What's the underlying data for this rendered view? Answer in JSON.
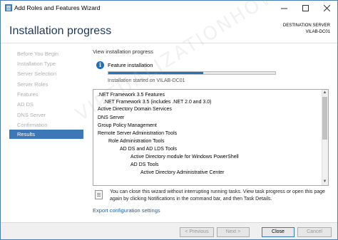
{
  "window": {
    "title": "Add Roles and Features Wizard"
  },
  "header": {
    "title": "Installation progress",
    "destination_label": "DESTINATION SERVER",
    "destination_server": "VILAB-DC01"
  },
  "sidebar": {
    "items": [
      {
        "label": "Before You Begin",
        "active": false
      },
      {
        "label": "Installation Type",
        "active": false
      },
      {
        "label": "Server Selection",
        "active": false
      },
      {
        "label": "Server Roles",
        "active": false
      },
      {
        "label": "Features",
        "active": false
      },
      {
        "label": "AD DS",
        "active": false
      },
      {
        "label": "DNS Server",
        "active": false
      },
      {
        "label": "Confirmation",
        "active": false
      },
      {
        "label": "Results",
        "active": true
      }
    ]
  },
  "main": {
    "view_label": "View installation progress",
    "feature_installation": "Feature installation",
    "progress_fraction": 0.57,
    "install_started": "Installation started on VILAB-DC01",
    "results": [
      ".NET Framework 3.5 Features",
      ".NET Framework 3.5 (includes .NET 2.0 and 3.0)",
      "Active Directory Domain Services",
      "DNS Server",
      "Group Policy Management",
      "Remote Server Administration Tools",
      "Role Administration Tools",
      "AD DS and AD LDS Tools",
      "Active Directory module for Windows PowerShell",
      "AD DS Tools",
      "Active Directory Administrative Center"
    ],
    "note": "You can close this wizard without interrupting running tasks. View task progress or open this page again by clicking Notifications in the command bar, and then Task Details.",
    "export_link": "Export configuration settings"
  },
  "footer": {
    "previous": "< Previous",
    "next": "Next >",
    "close": "Close",
    "cancel": "Cancel"
  },
  "watermark": "VIRTUALIZATIONHOWTO.COM",
  "colors": {
    "accent": "#3c78b8",
    "title": "#1e395b",
    "progress": "#2372be",
    "link": "#1e5fa6"
  }
}
